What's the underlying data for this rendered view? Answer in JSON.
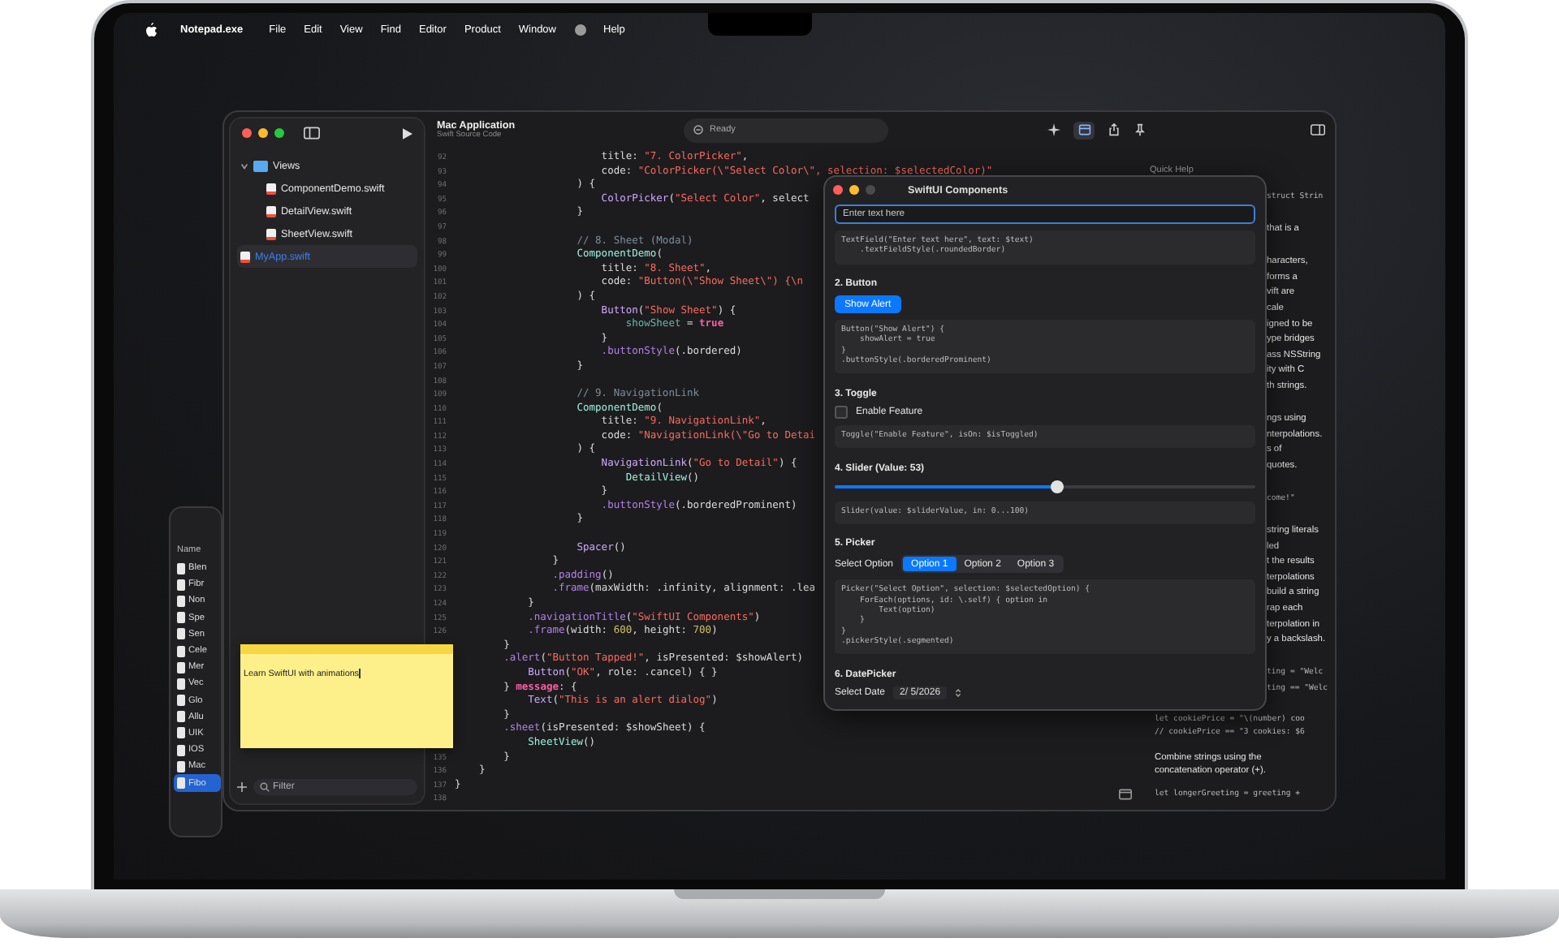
{
  "menu_bar": {
    "items": [
      {
        "kind": "app",
        "label": "Notepad.exe"
      },
      {
        "kind": "item",
        "label": "File"
      },
      {
        "kind": "item",
        "label": "Edit"
      },
      {
        "kind": "item",
        "label": "View"
      },
      {
        "kind": "item",
        "label": "Find"
      },
      {
        "kind": "item",
        "label": "Editor"
      },
      {
        "kind": "item",
        "label": "Product"
      },
      {
        "kind": "item",
        "label": "Window"
      },
      {
        "kind": "icon"
      },
      {
        "kind": "item",
        "label": "Help"
      }
    ]
  },
  "finder_window": {
    "header": "Name",
    "rows": [
      {
        "name": "Blen",
        "selected": false
      },
      {
        "name": "Fibr",
        "selected": false
      },
      {
        "name": "Non",
        "selected": false
      },
      {
        "name": "Spe",
        "selected": false
      },
      {
        "name": "Sen",
        "selected": false
      },
      {
        "name": "Cele",
        "selected": false
      },
      {
        "name": "Mer",
        "selected": false
      },
      {
        "name": "Vec",
        "selected": false
      },
      {
        "name": "Glo",
        "selected": false
      },
      {
        "name": "Allu",
        "selected": false
      },
      {
        "name": "UIK",
        "selected": false
      },
      {
        "name": "IOS",
        "selected": false
      },
      {
        "name": "Mac",
        "selected": false
      },
      {
        "name": "Fibo",
        "selected": true
      }
    ]
  },
  "xcode": {
    "toolbar": {
      "title": "Mac Application",
      "subtitle": "Swift Source Code",
      "status": "Ready"
    },
    "navigator": {
      "items": [
        {
          "name": "Views",
          "kind": "folder",
          "expanded": true,
          "selected": false,
          "children": [
            {
              "name": "ComponentDemo.swift",
              "kind": "file",
              "selected": false
            },
            {
              "name": "DetailView.swift",
              "kind": "file",
              "selected": false
            },
            {
              "name": "SheetView.swift",
              "kind": "file",
              "selected": false
            }
          ]
        },
        {
          "name": "MyApp.swift",
          "kind": "file",
          "selected": true
        }
      ],
      "filter_placeholder": "Filter"
    },
    "editor": {
      "lines": [
        {
          "n": "92",
          "tokens": [
            {
              "kind": "plain",
              "text": "                        title: "
            },
            {
              "kind": "string",
              "text": "\"7. ColorPicker\""
            },
            {
              "kind": "plain",
              "text": ","
            }
          ]
        },
        {
          "n": "93",
          "tokens": [
            {
              "kind": "plain",
              "text": "                        code: "
            },
            {
              "kind": "string",
              "text": "\"ColorPicker(\\\"Select Color\\\", selection: $selectedColor)\""
            }
          ]
        },
        {
          "n": "94",
          "tokens": [
            {
              "kind": "plain",
              "text": "                    ) {"
            }
          ]
        },
        {
          "n": "95",
          "tokens": [
            {
              "kind": "call",
              "text": "                        ColorPicker"
            },
            {
              "kind": "plain",
              "text": "("
            },
            {
              "kind": "string",
              "text": "\"Select Color\""
            },
            {
              "kind": "plain",
              "text": ", select"
            }
          ]
        },
        {
          "n": "96",
          "tokens": [
            {
              "kind": "plain",
              "text": "                    }"
            }
          ]
        },
        {
          "n": "97"
        },
        {
          "n": "98",
          "tokens": [
            {
              "kind": "comment",
              "text": "                    // 8. Sheet (Modal)"
            }
          ]
        },
        {
          "n": "99",
          "tokens": [
            {
              "kind": "type",
              "text": "                    ComponentDemo"
            },
            {
              "kind": "plain",
              "text": "("
            }
          ]
        },
        {
          "n": "100",
          "tokens": [
            {
              "kind": "plain",
              "text": "                        title: "
            },
            {
              "kind": "string",
              "text": "\"8. Sheet\""
            },
            {
              "kind": "plain",
              "text": ","
            }
          ]
        },
        {
          "n": "101",
          "tokens": [
            {
              "kind": "plain",
              "text": "                        code: "
            },
            {
              "kind": "string",
              "text": "\"Button(\\\"Show Sheet\\\") {\\n"
            }
          ]
        },
        {
          "n": "102",
          "tokens": [
            {
              "kind": "plain",
              "text": "                    ) {"
            }
          ]
        },
        {
          "n": "103",
          "tokens": [
            {
              "kind": "call",
              "text": "                        Button"
            },
            {
              "kind": "plain",
              "text": "("
            },
            {
              "kind": "string",
              "text": "\"Show Sheet\""
            },
            {
              "kind": "plain",
              "text": ") {"
            }
          ]
        },
        {
          "n": "104",
          "tokens": [
            {
              "kind": "var",
              "text": "                            showSheet"
            },
            {
              "kind": "plain",
              "text": " = "
            },
            {
              "kind": "keyword",
              "text": "true"
            }
          ]
        },
        {
          "n": "105",
          "tokens": [
            {
              "kind": "plain",
              "text": "                        }"
            }
          ]
        },
        {
          "n": "106",
          "tokens": [
            {
              "kind": "member",
              "text": "                        .buttonStyle"
            },
            {
              "kind": "plain",
              "text": "(.bordered)"
            }
          ]
        },
        {
          "n": "107",
          "tokens": [
            {
              "kind": "plain",
              "text": "                    }"
            }
          ]
        },
        {
          "n": "108"
        },
        {
          "n": "109",
          "tokens": [
            {
              "kind": "comment",
              "text": "                    // 9. NavigationLink"
            }
          ]
        },
        {
          "n": "110",
          "tokens": [
            {
              "kind": "type",
              "text": "                    ComponentDemo"
            },
            {
              "kind": "plain",
              "text": "("
            }
          ]
        },
        {
          "n": "111",
          "tokens": [
            {
              "kind": "plain",
              "text": "                        title: "
            },
            {
              "kind": "string",
              "text": "\"9. NavigationLink\""
            },
            {
              "kind": "plain",
              "text": ","
            }
          ]
        },
        {
          "n": "112",
          "tokens": [
            {
              "kind": "plain",
              "text": "                        code: "
            },
            {
              "kind": "string",
              "text": "\"NavigationLink(\\\"Go to Detai"
            }
          ]
        },
        {
          "n": "113",
          "tokens": [
            {
              "kind": "plain",
              "text": "                    ) {"
            }
          ]
        },
        {
          "n": "114",
          "tokens": [
            {
              "kind": "call",
              "text": "                        NavigationLink"
            },
            {
              "kind": "plain",
              "text": "("
            },
            {
              "kind": "string",
              "text": "\"Go to Detail\""
            },
            {
              "kind": "plain",
              "text": ") {"
            }
          ]
        },
        {
          "n": "115",
          "tokens": [
            {
              "kind": "type",
              "text": "                            DetailView"
            },
            {
              "kind": "plain",
              "text": "()"
            }
          ]
        },
        {
          "n": "116",
          "tokens": [
            {
              "kind": "plain",
              "text": "                        }"
            }
          ]
        },
        {
          "n": "117",
          "tokens": [
            {
              "kind": "member",
              "text": "                        .buttonStyle"
            },
            {
              "kind": "plain",
              "text": "(.borderedProminent)"
            }
          ]
        },
        {
          "n": "118",
          "tokens": [
            {
              "kind": "plain",
              "text": "                    }"
            }
          ]
        },
        {
          "n": "119"
        },
        {
          "n": "120",
          "tokens": [
            {
              "kind": "call",
              "text": "                    Spacer"
            },
            {
              "kind": "plain",
              "text": "()"
            }
          ]
        },
        {
          "n": "121",
          "tokens": [
            {
              "kind": "plain",
              "text": "                }"
            }
          ]
        },
        {
          "n": "122",
          "tokens": [
            {
              "kind": "member",
              "text": "                .padding"
            },
            {
              "kind": "plain",
              "text": "()"
            }
          ]
        },
        {
          "n": "123",
          "tokens": [
            {
              "kind": "member",
              "text": "                .frame"
            },
            {
              "kind": "plain",
              "text": "(maxWidth: .infinity, alignment: .lea"
            }
          ]
        },
        {
          "n": "124",
          "tokens": [
            {
              "kind": "plain",
              "text": "            }"
            }
          ]
        },
        {
          "n": "125",
          "tokens": [
            {
              "kind": "member",
              "text": "            .navigationTitle"
            },
            {
              "kind": "plain",
              "text": "("
            },
            {
              "kind": "string",
              "text": "\"SwiftUI Components\""
            },
            {
              "kind": "plain",
              "text": ")"
            }
          ]
        },
        {
          "n": "126",
          "tokens": [
            {
              "kind": "member",
              "text": "            .frame"
            },
            {
              "kind": "plain",
              "text": "(width: "
            },
            {
              "kind": "number",
              "text": "600"
            },
            {
              "kind": "plain",
              "text": ", height: "
            },
            {
              "kind": "number",
              "text": "700"
            },
            {
              "kind": "plain",
              "text": ")"
            }
          ]
        },
        {
          "tokens": [
            {
              "kind": "plain",
              "text": "        }"
            }
          ]
        },
        {
          "tokens": [
            {
              "kind": "member",
              "text": "        .alert"
            },
            {
              "kind": "plain",
              "text": "("
            },
            {
              "kind": "string",
              "text": "\"Button Tapped!\""
            },
            {
              "kind": "plain",
              "text": ", isPresented: $showAlert)"
            }
          ]
        },
        {
          "tokens": [
            {
              "kind": "call",
              "text": "            Button"
            },
            {
              "kind": "plain",
              "text": "("
            },
            {
              "kind": "string",
              "text": "\"OK\""
            },
            {
              "kind": "plain",
              "text": ", role: .cancel) { }"
            }
          ]
        },
        {
          "tokens": [
            {
              "kind": "plain",
              "text": "        } "
            },
            {
              "kind": "keyword",
              "text": "message"
            },
            {
              "kind": "plain",
              "text": ": {"
            }
          ]
        },
        {
          "tokens": [
            {
              "kind": "call",
              "text": "            Text"
            },
            {
              "kind": "plain",
              "text": "("
            },
            {
              "kind": "string",
              "text": "\"This is an alert dialog\""
            },
            {
              "kind": "plain",
              "text": ")"
            }
          ]
        },
        {
          "tokens": [
            {
              "kind": "plain",
              "text": "        }"
            }
          ]
        },
        {
          "tokens": [
            {
              "kind": "member",
              "text": "        .sheet"
            },
            {
              "kind": "plain",
              "text": "(isPresented: $showSheet) {"
            }
          ]
        },
        {
          "tokens": [
            {
              "kind": "type",
              "text": "            SheetView"
            },
            {
              "kind": "plain",
              "text": "()"
            }
          ]
        },
        {
          "n": "135",
          "tokens": [
            {
              "kind": "plain",
              "text": "        }"
            }
          ]
        },
        {
          "n": "136",
          "tokens": [
            {
              "kind": "plain",
              "text": "    }"
            }
          ]
        },
        {
          "n": "137",
          "tokens": [
            {
              "kind": "plain",
              "text": "}"
            }
          ]
        },
        {
          "n": "138"
        }
      ]
    },
    "quick_help": {
      "title": "Quick Help",
      "paragraphs": [
        {
          "kind": "code",
          "partly_hidden": true,
          "lines": [
            "struct Strin"
          ]
        },
        {
          "kind": "text",
          "partly_hidden": true,
          "lines": [
            "that is a"
          ]
        },
        {
          "kind": "text",
          "partly_hidden": true,
          "lines": [
            "haracters,",
            "forms a",
            "vift are",
            "cale",
            "igned to be",
            "ype bridges",
            "ass NSString",
            "ity with C",
            "th strings."
          ]
        },
        {
          "kind": "text",
          "partly_hidden": true,
          "lines": [
            "ngs using",
            "nterpolations.",
            "s of",
            "quotes."
          ]
        },
        {
          "kind": "code",
          "partly_hidden": true,
          "lines": [
            "come!\""
          ]
        },
        {
          "kind": "text",
          "partly_hidden": true,
          "lines": [
            "string literals",
            "led",
            "t the results",
            "terpolations",
            "build a string",
            "rap each",
            "terpolation in",
            "y a backslash."
          ]
        },
        {
          "kind": "code",
          "partly_hidden": true,
          "lines": [
            "ting = \"Welc",
            "ting == \"Welc"
          ]
        },
        {
          "kind": "code",
          "partly_hidden": false,
          "lines": [
            "let cookiePrice = \"\\(number) coo",
            "// cookiePrice == \"3 cookies: $6"
          ]
        },
        {
          "kind": "text",
          "partly_hidden": false,
          "lines": [
            "Combine strings using the",
            "concatenation operator (+)."
          ]
        },
        {
          "kind": "code",
          "partly_hidden": false,
          "lines": [
            "let longerGreeting = greeting +"
          ]
        }
      ]
    }
  },
  "swiftui_window": {
    "title": "SwiftUI Components",
    "sections": [
      {
        "kind": "textfield",
        "placeholder": "Enter text here",
        "code": [
          "TextField(\"Enter text here\", text: $text)",
          "    .textFieldStyle(.roundedBorder)"
        ]
      },
      {
        "kind": "button",
        "heading": "2. Button",
        "button": "Show Alert",
        "code": [
          "Button(\"Show Alert\") {",
          "    showAlert = true",
          "}",
          ".buttonStyle(.borderedProminent)"
        ]
      },
      {
        "kind": "toggle",
        "heading": "3. Toggle",
        "label": "Enable Feature",
        "checked": false,
        "code": [
          "Toggle(\"Enable Feature\", isOn: $isToggled)"
        ]
      },
      {
        "kind": "slider",
        "heading": "4. Slider (Value: 53)",
        "level": 0.53,
        "code": [
          "Slider(value: $sliderValue, in: 0...100)"
        ]
      },
      {
        "kind": "picker",
        "heading": "5. Picker",
        "label": "Select Option",
        "options": [
          {
            "label": "Option 1",
            "selected": true
          },
          {
            "label": "Option 2",
            "selected": false
          },
          {
            "label": "Option 3",
            "selected": false
          }
        ],
        "code": [
          "Picker(\"Select Option\", selection: $selectedOption) {",
          "    ForEach(options, id: \\.self) { option in",
          "        Text(option)",
          "    }",
          "}",
          ".pickerStyle(.segmented)"
        ]
      },
      {
        "kind": "datepicker",
        "heading": "6. DatePicker",
        "label": "Select Date",
        "value": "2/ 5/2026"
      }
    ]
  },
  "sticky_note": {
    "text": "Learn SwiftUI with animations"
  }
}
